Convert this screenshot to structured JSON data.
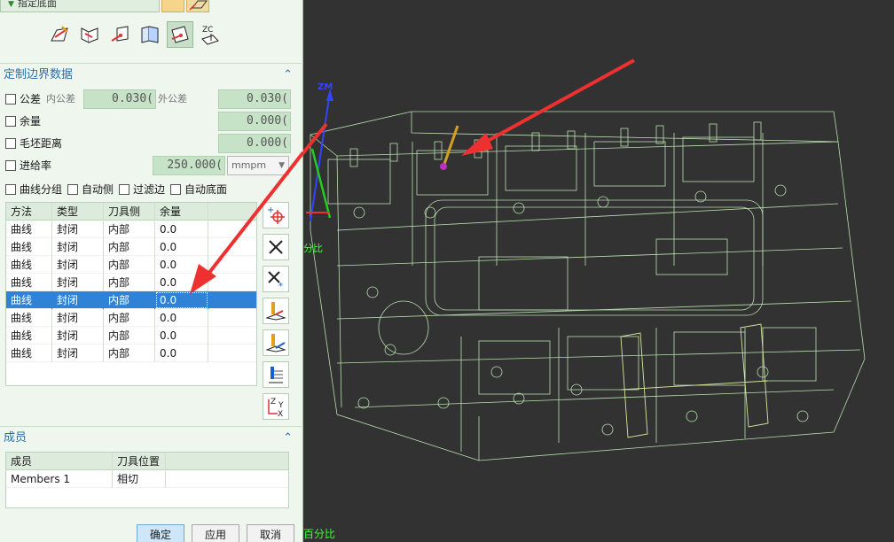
{
  "top": {
    "selector_label": "指定底面"
  },
  "toolbar_icons": [
    {
      "name": "curve-boundary-icon"
    },
    {
      "name": "plane-boundary-icon"
    },
    {
      "name": "point-boundary-icon"
    },
    {
      "name": "face-boundary-icon"
    },
    {
      "name": "plane-normal-icon"
    },
    {
      "name": "zc-axis-icon",
      "text": "ZC"
    }
  ],
  "custom_boundary": {
    "title": "定制边界数据",
    "tolerance": {
      "label": "公差",
      "inner_label": "内公差",
      "inner_value": "0.030(",
      "outer_label": "外公差",
      "outer_value": "0.030("
    },
    "stock": {
      "label": "余量",
      "value": "0.000("
    },
    "blank_distance": {
      "label": "毛坯距离",
      "value": "0.000("
    },
    "feed_rate": {
      "label": "进给率",
      "value": "250.000(",
      "unit": "mmpm"
    },
    "options": {
      "curve_group": "曲线分组",
      "auto_side": "自动侧",
      "filter_edges": "过滤边",
      "auto_floor": "自动底面"
    }
  },
  "boundary_table": {
    "headers": [
      "方法",
      "类型",
      "刀具侧",
      "余量"
    ],
    "rows": [
      [
        "曲线",
        "封闭",
        "内部",
        "0.0"
      ],
      [
        "曲线",
        "封闭",
        "内部",
        "0.0"
      ],
      [
        "曲线",
        "封闭",
        "内部",
        "0.0"
      ],
      [
        "曲线",
        "封闭",
        "内部",
        "0.0"
      ],
      [
        "曲线",
        "封闭",
        "内部",
        "0.0"
      ],
      [
        "曲线",
        "封闭",
        "内部",
        "0.0"
      ],
      [
        "曲线",
        "封闭",
        "内部",
        "0.0"
      ],
      [
        "曲线",
        "封闭",
        "内部",
        "0.0"
      ]
    ],
    "selected_index": 4
  },
  "side_buttons": [
    {
      "name": "add-boundary-icon"
    },
    {
      "name": "delete-icon"
    },
    {
      "name": "delete-all-icon"
    },
    {
      "name": "tool-side-icon"
    },
    {
      "name": "edit-tool-icon"
    },
    {
      "name": "list-edit-icon"
    },
    {
      "name": "xyz-reorder-icon",
      "text": "Z Y X"
    }
  ],
  "members": {
    "title": "成员",
    "headers": [
      "成员",
      "刀具位置"
    ],
    "rows": [
      [
        "Members 1",
        "相切"
      ]
    ]
  },
  "dialog_buttons": {
    "ok": "确定",
    "apply": "应用",
    "cancel": "取消"
  },
  "viewport": {
    "axis_label": "ZM",
    "percent_label_top": "分比",
    "percent_label_bottom": "百分比"
  },
  "colors": {
    "accent": "#2a6fae",
    "selection": "#2f82d6",
    "panel_bg": "#eef6ee",
    "wireframe": "#b8e0b0",
    "viewport_bg": "#323232",
    "arrow": "#ee3030"
  }
}
